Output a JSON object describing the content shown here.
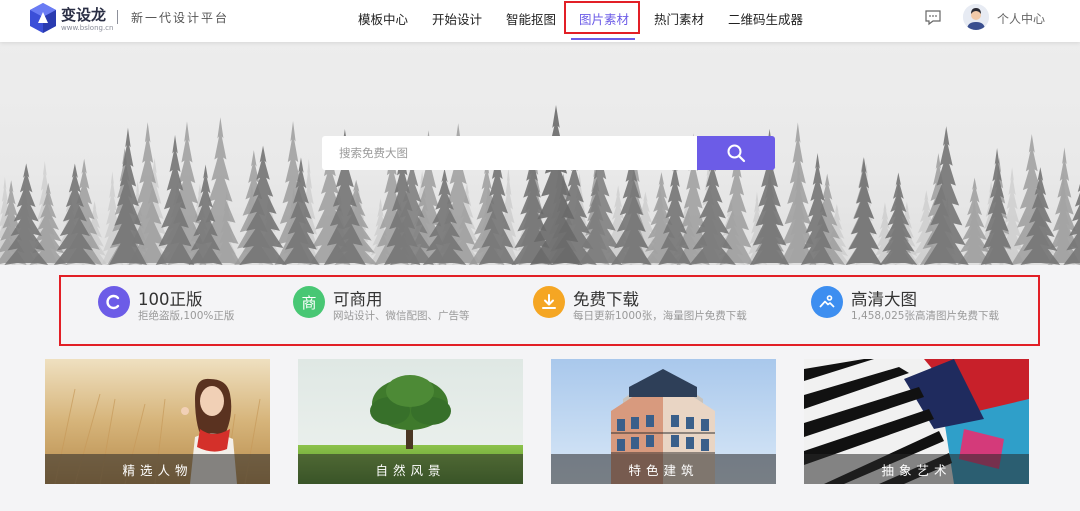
{
  "brand": {
    "name": "变设龙",
    "domain": "www.bslong.cn",
    "slogan": "新一代设计平台",
    "accent_color": "#6c5ce7"
  },
  "nav": {
    "items": [
      {
        "label": "模板中心"
      },
      {
        "label": "开始设计"
      },
      {
        "label": "智能抠图"
      },
      {
        "label": "图片素材",
        "active": true
      },
      {
        "label": "热门素材"
      },
      {
        "label": "二维码生成器"
      }
    ]
  },
  "header_right": {
    "message_icon": "chat-bubble-icon",
    "profile_label": "个人中心"
  },
  "search": {
    "placeholder": "搜索免费大图",
    "value": "",
    "button_icon": "search-icon"
  },
  "features": [
    {
      "title": "100正版",
      "desc": "拒绝盗版,100%正版",
      "icon": "copyright-icon",
      "glyph": "C",
      "color": "#6c5ce7"
    },
    {
      "title": "可商用",
      "desc": "网站设计、微信配图、广告等",
      "icon": "commercial-icon",
      "glyph": "商",
      "color": "#48c774"
    },
    {
      "title": "免费下载",
      "desc": "每日更新1000张，海量图片免费下载",
      "icon": "download-icon",
      "glyph": "",
      "color": "#f5a623"
    },
    {
      "title": "高清大图",
      "desc": "1,458,025张高清图片免费下载",
      "icon": "hd-image-icon",
      "glyph": "",
      "color": "#3d8ef0"
    }
  ],
  "categories": [
    {
      "label": "精选人物"
    },
    {
      "label": "自然风景"
    },
    {
      "label": "特色建筑"
    },
    {
      "label": "抽象艺术"
    }
  ],
  "highlight_color": "#e21f26"
}
